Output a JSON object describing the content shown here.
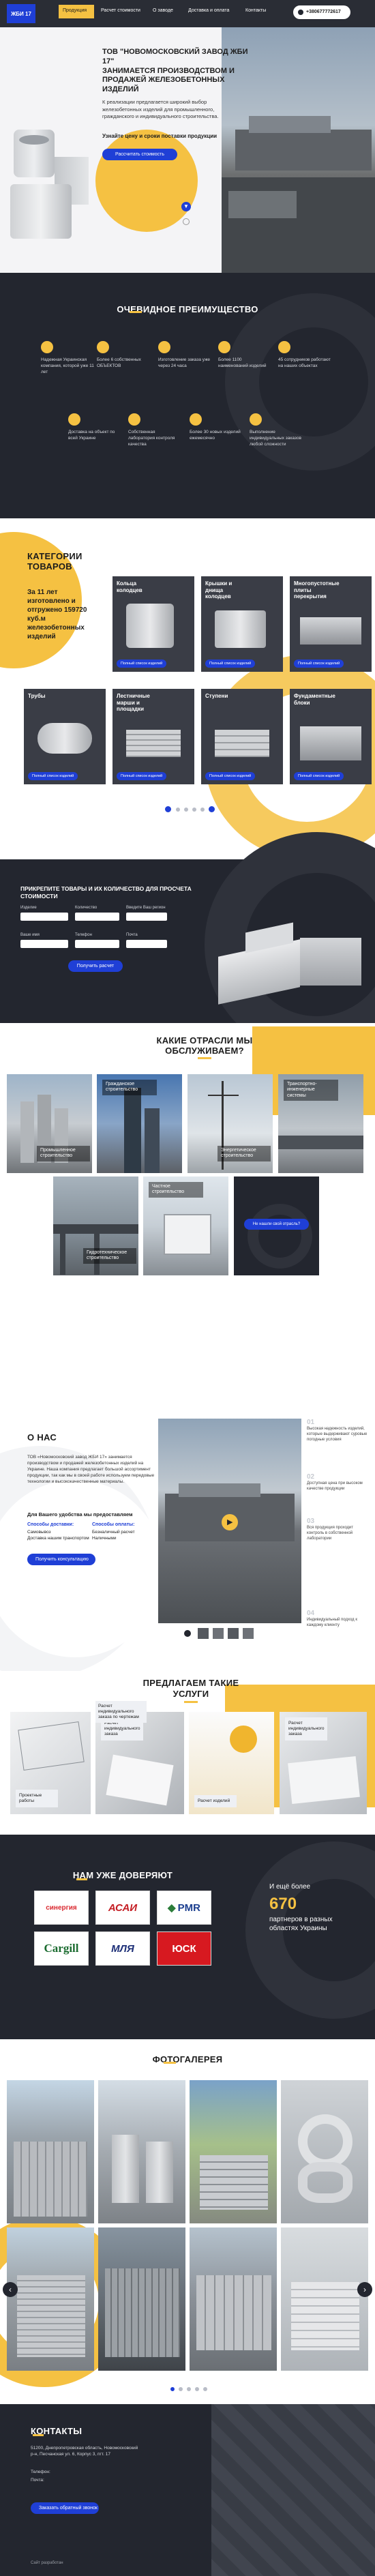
{
  "header": {
    "logo_text": "ЖБИ 17",
    "nav": [
      "Продукция",
      "Расчет стоимости",
      "О заводе",
      "Доставка и оплата",
      "Контакты"
    ],
    "phone": "+380677772617"
  },
  "hero": {
    "title_quote": "ТОВ \"НОВОМОСКОВСКИЙ ЗАВОД ЖБИ 17\"",
    "title_rest": "ЗАНИМАЕТСЯ ПРОИЗВОДСТВОМ И ПРОДАЖЕЙ ЖЕЛЕЗОБЕТОННЫХ ИЗДЕЛИЙ",
    "desc": "К реализации предлагается широкий выбор железобетонных изделий для промышленного, гражданского и индивидуального строительства.",
    "subtitle": "Узнайте цену и сроки поставки продукции",
    "button": "Рассчитать стоимость",
    "scroll_icon": "arrow-down"
  },
  "advantages": {
    "title": "ОЧЕВИДНОЕ ПРЕИМУЩЕСТВО",
    "items": [
      {
        "text": "Надежная Украинская компания, которой уже 11 лет",
        "icon": "map-icon"
      },
      {
        "text": "Более 6 собственных ОБЪЕКТОВ",
        "icon": "building-icon"
      },
      {
        "text": "Изготовление заказа уже через 24 часа",
        "icon": "clock-icon"
      },
      {
        "text": "Более 1100 наименований изделий",
        "icon": "box-icon"
      },
      {
        "text": "45 сотрудников работают на наших объектах",
        "icon": "people-icon"
      },
      {
        "text": "Доставка на объект по всей Украине",
        "icon": "truck-icon"
      },
      {
        "text": "Собственная лаборатория контроля качества",
        "icon": "flask-icon"
      },
      {
        "text": "Более 30 новых изделий ежемесячно",
        "icon": "plus-icon"
      },
      {
        "text": "Выполнение индивидуальных заказов любой сложности",
        "icon": "star-icon"
      }
    ]
  },
  "catalog": {
    "title": "КАТЕГОРИИ ТОВАРОВ",
    "intro": "За 11 лет изготовлено и отгружено 159720 куб.м железобетонных изделий",
    "card_button": "Полный список изделий",
    "cards": [
      "Кольца колодцев",
      "Крышки и днища колодцев",
      "Многопустотные плиты перекрытия",
      "Трубы",
      "Лестничные марши и площадки",
      "Ступени",
      "Фундаментные блоки"
    ]
  },
  "calc": {
    "title": "ПРИКРЕПИТЕ ТОВАРЫ И ИХ КОЛИЧЕСТВО ДЛЯ ПРОСЧЕТА СТОИМОСТИ",
    "label_product": "Изделие",
    "label_qty": "Количество",
    "label_region": "Введите Ваш регион",
    "label_name": "Ваше имя",
    "label_phone": "Телефон",
    "label_mail": "Почта",
    "button": "Получить расчет"
  },
  "industries": {
    "title": "КАКИЕ ОТРАСЛИ МЫ ОБСЛУЖИВАЕМ?",
    "items": [
      "Промышленное строительство",
      "Гражданское строительство",
      "Энергетическое строительство",
      "Транспортно-инженерные системы",
      "Гидротехническое строительство",
      "Частное строительство"
    ],
    "cta": "Не нашли свой отрасль?"
  },
  "about": {
    "title": "О НАС",
    "text": "ТОВ «Новомосковский завод ЖБИ 17» занимается производством и продажей железобетонных изделий на Украине. Наша компания предлагает большой ассортимент продукции, так как мы в своей работе используем передовые технологии и высококачественные материалы.",
    "sub": "Для Вашего удобства мы предоставляем",
    "col1_title": "Способы доставки:",
    "col1": [
      "Самовывоз",
      "Доставка нашим транспортом"
    ],
    "col2_title": "Способы оплаты:",
    "col2": [
      "Безналичный расчет",
      "Наличными"
    ],
    "button": "Получить консультацию",
    "side": [
      {
        "num": "01",
        "text": "Высокая надежность изделий, которые выдерживают суровые погодные условия"
      },
      {
        "num": "02",
        "text": "Доступная цена при высоком качестве продукции"
      },
      {
        "num": "03",
        "text": "Вся продукция проходит контроль в собственной лаборатории"
      },
      {
        "num": "04",
        "text": "Индивидуальный подход к каждому клиенту"
      }
    ]
  },
  "services": {
    "title": "ПРЕДЛАГАЕМ ТАКИЕ УСЛУГИ",
    "items": [
      "Проектные работы",
      "Расчет индивидуального заказа",
      "Расчет индивидуального заказа по чертежам",
      "Расчет индивидуального заказа",
      "Расчет изделий"
    ]
  },
  "partners": {
    "title": "НАМ УЖЕ ДОВЕРЯЮТ",
    "logos": [
      "синергия",
      "АСАИ",
      "PMR",
      "Cargill",
      "МЛЯ",
      "ЮСК"
    ],
    "side_pre": "И ещё более",
    "side_num": "670",
    "side_post": "партнеров в разных областях Украины"
  },
  "gallery": {
    "title": "ФОТОГАЛЕРЕЯ"
  },
  "contacts": {
    "title": "КОНТАКТЫ",
    "address": "51200, Днепропетровская область, Новомосковский р-н, Песчанская ул. 6, Корпус 3, пгт. 17",
    "phone_label": "Телефон:",
    "mail_label": "Почта:",
    "button": "Заказать обратный звонок",
    "footer": "Сайт разработан"
  },
  "colors": {
    "accent": "#1f3fd6",
    "yellow": "#f5c142",
    "dark": "#23262f"
  }
}
